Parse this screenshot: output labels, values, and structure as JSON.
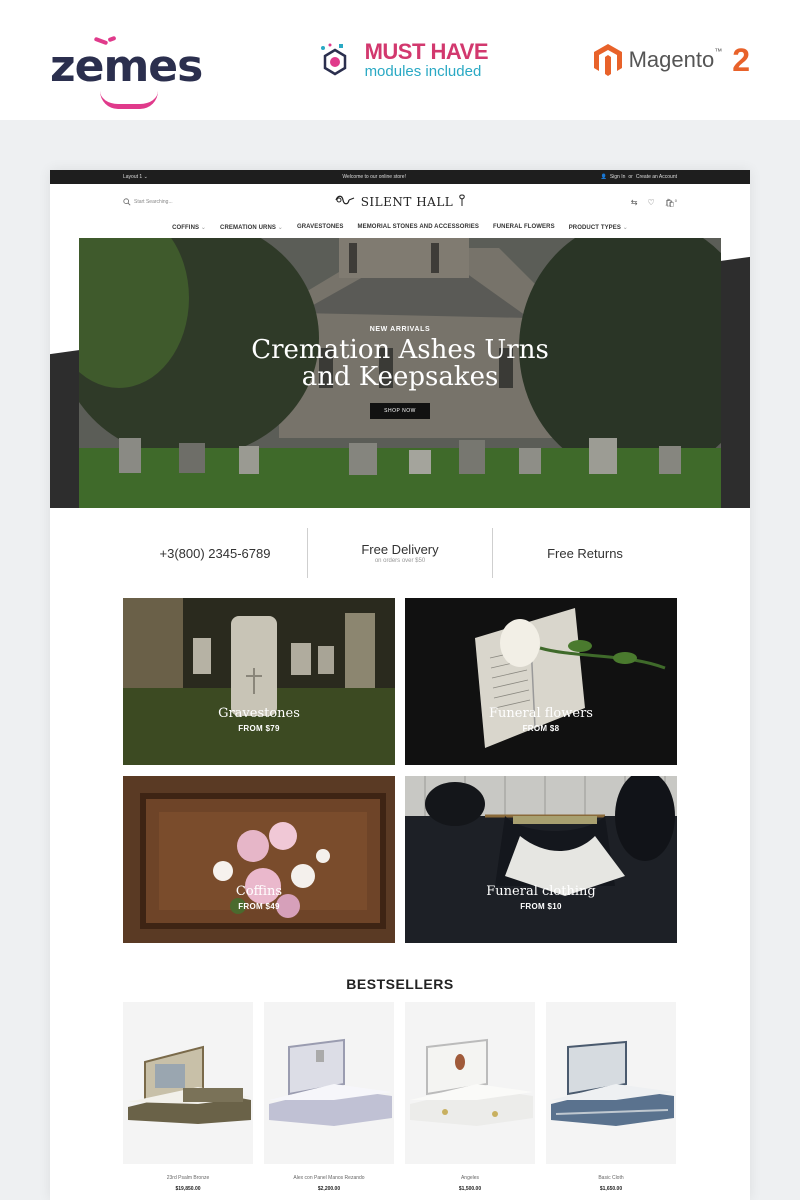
{
  "promo": {
    "brand": "zemes",
    "badge_line1": "MUST HAVE",
    "badge_line2": "modules included",
    "platform": "Magento",
    "platform_tm": "™",
    "platform_version": "2"
  },
  "topbar": {
    "layout": "Layout 1",
    "welcome": "Welcome to our online store!",
    "sign_in": "Sign In",
    "or": "or",
    "create_account": "Create an Account"
  },
  "header": {
    "search_placeholder": "Start Searching...",
    "logo": "SILENT HALL",
    "cart_count": "0"
  },
  "nav": [
    {
      "label": "COFFINS"
    },
    {
      "label": "CREMATION URNS"
    },
    {
      "label": "GRAVESTONES"
    },
    {
      "label": "MEMORIAL STONES AND ACCESSORIES"
    },
    {
      "label": "FUNERAL FLOWERS"
    },
    {
      "label": "PRODUCT TYPES"
    }
  ],
  "hero": {
    "kicker": "NEW ARRIVALS",
    "title_line1": "Cremation Ashes Urns",
    "title_line2": "and Keepsakes",
    "button": "SHOP NOW"
  },
  "features": [
    {
      "main": "+3(800) 2345-6789",
      "sub": ""
    },
    {
      "main": "Free Delivery",
      "sub": "on orders over $50"
    },
    {
      "main": "Free Returns",
      "sub": ""
    }
  ],
  "categories": [
    {
      "name": "Gravestones",
      "from": "FROM $79"
    },
    {
      "name": "Funeral flowers",
      "from": "FROM $8"
    },
    {
      "name": "Coffins",
      "from": "FROM $49"
    },
    {
      "name": "Funeral clothing",
      "from": "FROM $10"
    }
  ],
  "bestsellers": {
    "title": "BESTSELLERS",
    "items": [
      {
        "name": "23rd Psalm Bronze",
        "price": "$19,850.00"
      },
      {
        "name": "Alex con Panel Manos Rezando",
        "price": "$2,200.00"
      },
      {
        "name": "Angeles",
        "price": "$1,500.00"
      },
      {
        "name": "Basic Cloth",
        "price": "$1,650.00"
      }
    ]
  },
  "colors": {
    "brand_pink": "#e03a8b",
    "brand_navy": "#2b2f4e",
    "magento_orange": "#e8622a",
    "topbar": "#1e1e1e"
  }
}
